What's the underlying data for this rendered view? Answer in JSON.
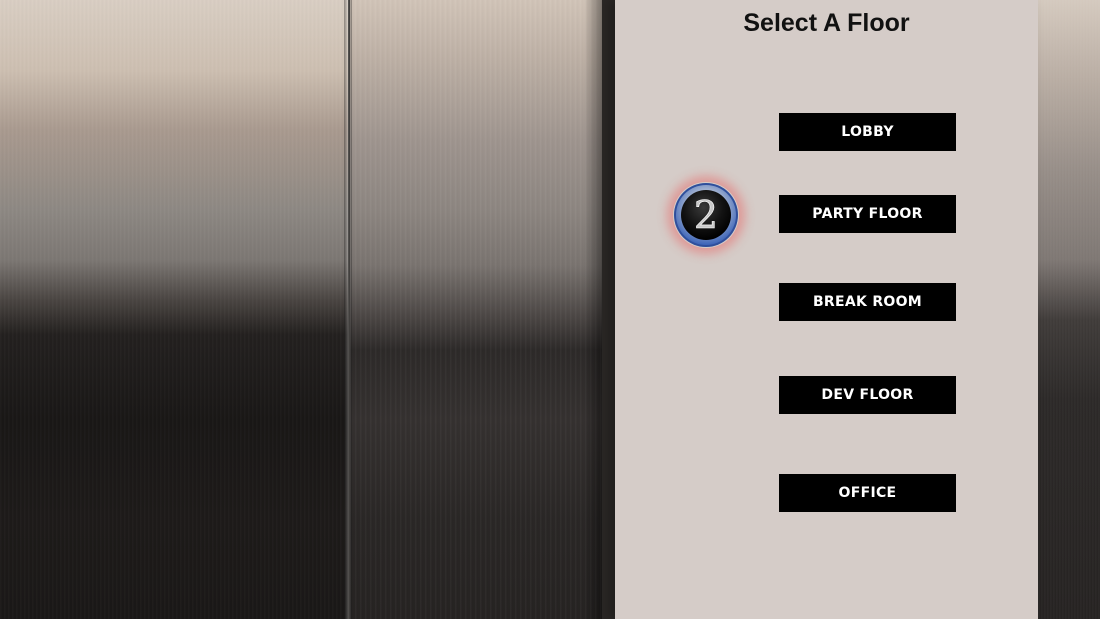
{
  "panel": {
    "title": "Select A Floor"
  },
  "indicator": {
    "current_floor": "2",
    "icon": "floor-number-indicator-icon"
  },
  "floors": [
    {
      "label": "LOBBY"
    },
    {
      "label": "PARTY FLOOR"
    },
    {
      "label": "BREAK ROOM"
    },
    {
      "label": "DEV FLOOR"
    },
    {
      "label": "OFFICE"
    }
  ],
  "colors": {
    "panel_background": "#d5ccc8",
    "button_background": "#000000",
    "button_text": "#ffffff",
    "title_text": "#111111",
    "indicator_glow": "#e85a5a",
    "indicator_ring": "#3b63b8"
  }
}
